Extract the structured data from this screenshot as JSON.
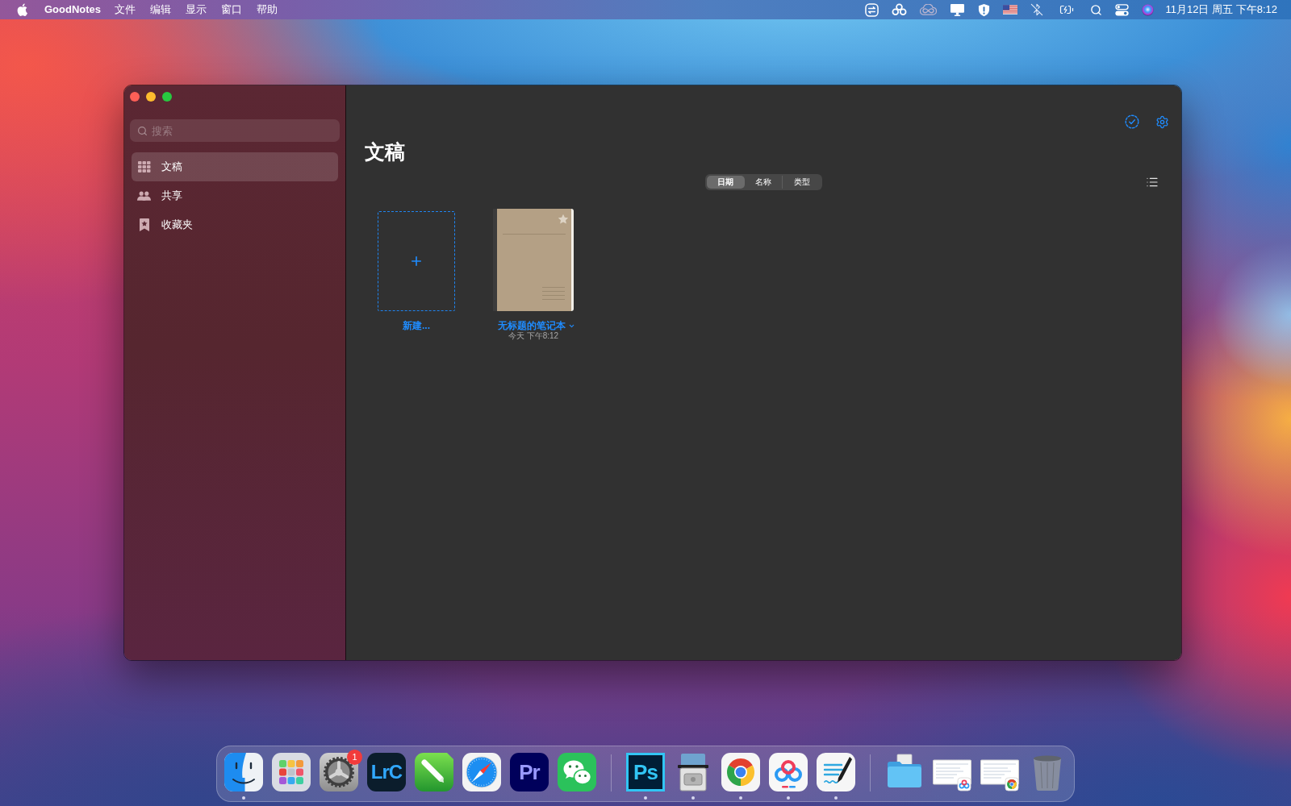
{
  "menu_bar": {
    "app_name": "GoodNotes",
    "menus": [
      "文件",
      "编辑",
      "显示",
      "窗口",
      "帮助"
    ],
    "clock": "11月12日 周五 下午8:12"
  },
  "window": {
    "sidebar": {
      "search": {
        "placeholder": "搜索"
      },
      "items": [
        {
          "kind": "grid",
          "label": "文稿",
          "selected": true
        },
        {
          "kind": "people",
          "label": "共享",
          "selected": false
        },
        {
          "kind": "bookmark",
          "label": "收藏夹",
          "selected": false
        }
      ]
    },
    "main": {
      "title": "文稿",
      "sort_options": [
        {
          "label": "日期",
          "selected": true
        },
        {
          "label": "名称",
          "selected": false
        },
        {
          "label": "类型",
          "selected": false
        }
      ],
      "documents": [
        {
          "kind": "new",
          "title": "新建..."
        },
        {
          "kind": "notebook",
          "title": "无标题的笔记本",
          "subtitle": "今天 下午8:12",
          "starred": false
        }
      ]
    }
  },
  "dock": {
    "groups": [
      {
        "apps": [
          {
            "kind": "face",
            "running": true
          },
          {
            "kind": "grid",
            "running": false
          },
          {
            "kind": "gear",
            "running": false,
            "badge": "1"
          },
          {
            "kind": "lettered-blue",
            "label": "LrC",
            "running": false
          },
          {
            "kind": "pencil",
            "running": false
          },
          {
            "kind": "compass",
            "running": false
          },
          {
            "kind": "lettered-violet",
            "label": "Pr",
            "running": false
          },
          {
            "kind": "chat",
            "running": false
          }
        ]
      },
      {
        "apps": [
          {
            "kind": "lettered-cyan",
            "label": "Ps",
            "running": true
          },
          {
            "kind": "disk",
            "running": true
          },
          {
            "kind": "ring",
            "running": true
          },
          {
            "kind": "rings",
            "running": true
          },
          {
            "kind": "pen-notes",
            "running": true
          }
        ]
      },
      {
        "apps": [
          {
            "kind": "folder",
            "running": false
          },
          {
            "kind": "window-rings",
            "running": false
          },
          {
            "kind": "window-ring",
            "running": false
          },
          {
            "kind": "trash",
            "running": false
          }
        ]
      }
    ]
  }
}
